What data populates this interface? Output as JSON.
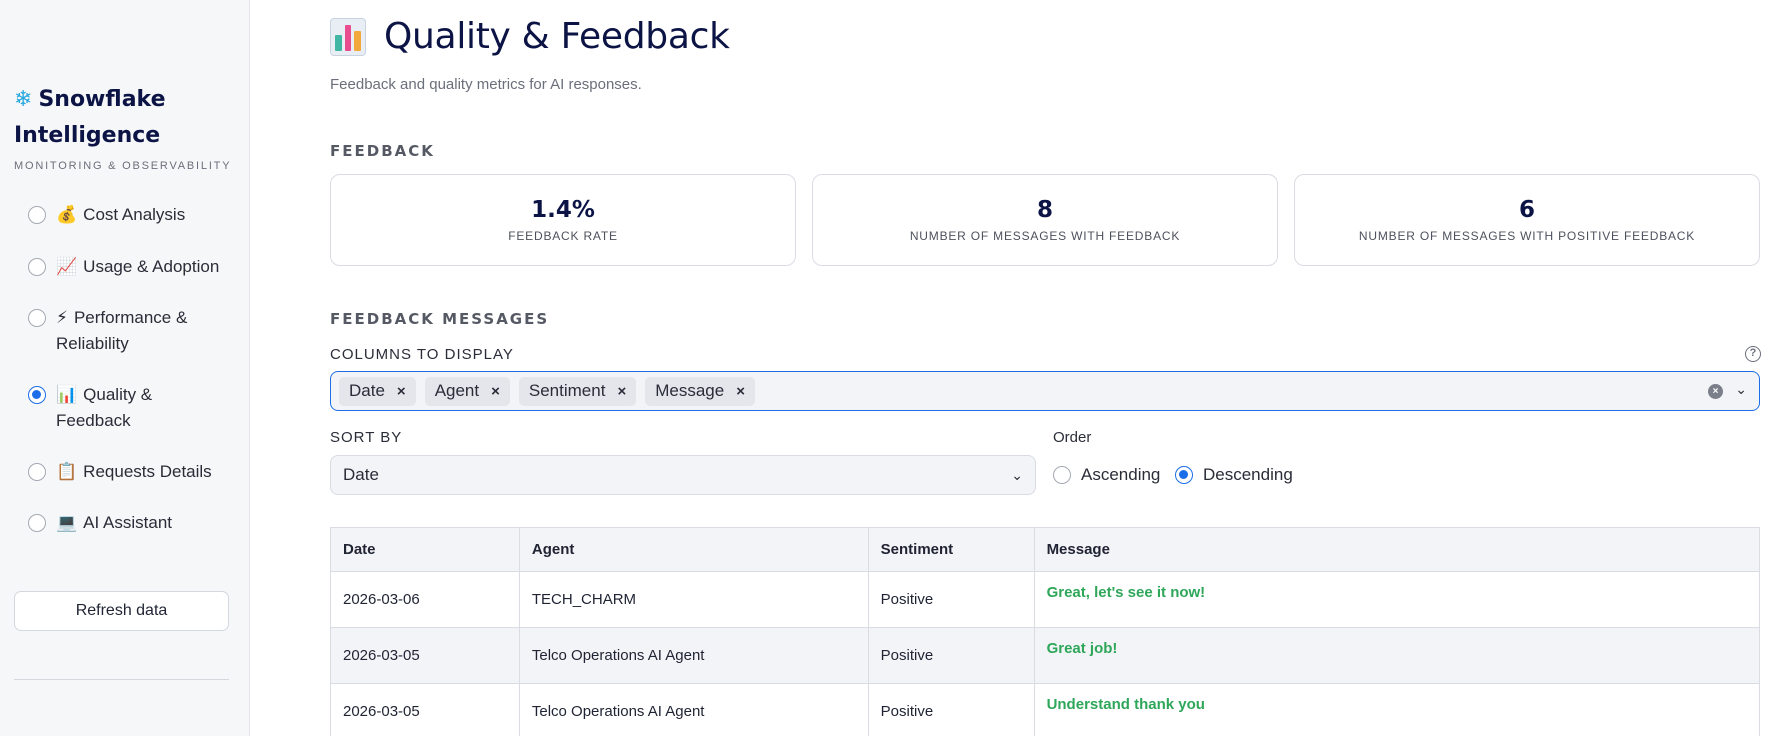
{
  "sidebar": {
    "brand_icon": "snowflake-icon",
    "brand_title_line1": "Snowflake",
    "brand_title_line2": "Intelligence",
    "brand_subtitle": "MONITORING & OBSERVABILITY",
    "items": [
      {
        "icon": "money-bag-icon",
        "glyph": "💰",
        "label": "Cost Analysis",
        "selected": false
      },
      {
        "icon": "chart-increasing-icon",
        "glyph": "📈",
        "label": "Usage & Adoption",
        "selected": false
      },
      {
        "icon": "lightning-icon",
        "glyph": "⚡",
        "label": "Performance & Reliability",
        "selected": false
      },
      {
        "icon": "bar-chart-icon",
        "glyph": "📊",
        "label": "Quality & Feedback",
        "selected": true
      },
      {
        "icon": "clipboard-icon",
        "glyph": "📋",
        "label": "Requests Details",
        "selected": false
      },
      {
        "icon": "laptop-icon",
        "glyph": "💻",
        "label": "AI Assistant",
        "selected": false
      }
    ],
    "refresh_label": "Refresh data"
  },
  "page": {
    "title": "Quality & Feedback",
    "description": "Feedback and quality metrics for AI responses."
  },
  "feedback": {
    "heading": "FEEDBACK",
    "metrics": [
      {
        "value": "1.4%",
        "label": "FEEDBACK RATE"
      },
      {
        "value": "8",
        "label": "NUMBER OF MESSAGES WITH FEEDBACK"
      },
      {
        "value": "6",
        "label": "NUMBER OF MESSAGES WITH POSITIVE FEEDBACK"
      }
    ]
  },
  "messages": {
    "heading": "FEEDBACK MESSAGES",
    "columns_label": "COLUMNS TO DISPLAY",
    "columns": [
      "Date",
      "Agent",
      "Sentiment",
      "Message"
    ],
    "sort_label": "SORT BY",
    "sort_value": "Date",
    "order_label": "Order",
    "order_options": [
      "Ascending",
      "Descending"
    ],
    "order_selected": "Descending",
    "table_headers": [
      "Date",
      "Agent",
      "Sentiment",
      "Message"
    ],
    "rows": [
      {
        "date": "2026-03-06",
        "agent": "TECH_CHARM",
        "sentiment": "Positive",
        "message": "Great, let's see it now!"
      },
      {
        "date": "2026-03-05",
        "agent": "Telco Operations AI Agent",
        "sentiment": "Positive",
        "message": "Great job!"
      },
      {
        "date": "2026-03-05",
        "agent": "Telco Operations AI Agent",
        "sentiment": "Positive",
        "message": "Understand thank you"
      }
    ]
  },
  "colors": {
    "accent": "#1c6ee8",
    "title": "#0c1445",
    "positive_message": "#2ea75a"
  }
}
